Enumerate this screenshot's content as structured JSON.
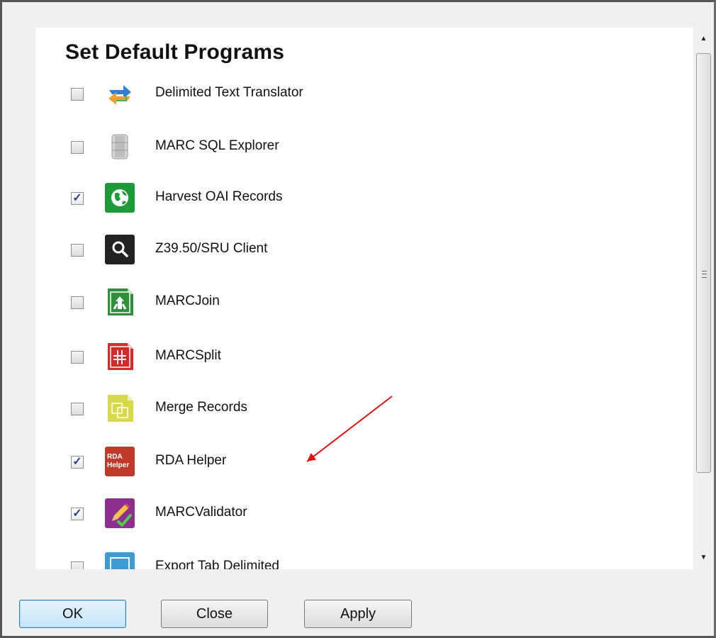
{
  "dialog": {
    "title": "Set Default Programs"
  },
  "programs": [
    {
      "label": "Delimited Text Translator",
      "checked": false,
      "icon": "swap-arrows-icon"
    },
    {
      "label": "MARC SQL Explorer",
      "checked": false,
      "icon": "database-icon"
    },
    {
      "label": "Harvest OAI Records",
      "checked": true,
      "icon": "globe-icon"
    },
    {
      "label": "Z39.50/SRU Client",
      "checked": false,
      "icon": "magnifier-icon"
    },
    {
      "label": "MARCJoin",
      "checked": false,
      "icon": "join-icon"
    },
    {
      "label": "MARCSplit",
      "checked": false,
      "icon": "split-icon"
    },
    {
      "label": "Merge Records",
      "checked": false,
      "icon": "merge-icon"
    },
    {
      "label": "RDA Helper",
      "checked": true,
      "icon": "rda-helper-icon",
      "icon_text": "RDA Helper"
    },
    {
      "label": "MARCValidator",
      "checked": true,
      "icon": "validator-icon"
    },
    {
      "label": "Export Tab Delimited",
      "checked": false,
      "icon": "export-icon"
    }
  ],
  "buttons": {
    "ok": "OK",
    "close": "Close",
    "apply": "Apply"
  },
  "scrollbar": {
    "up": "▲",
    "down": "▼"
  },
  "annotation": {
    "color": "#e01010"
  }
}
